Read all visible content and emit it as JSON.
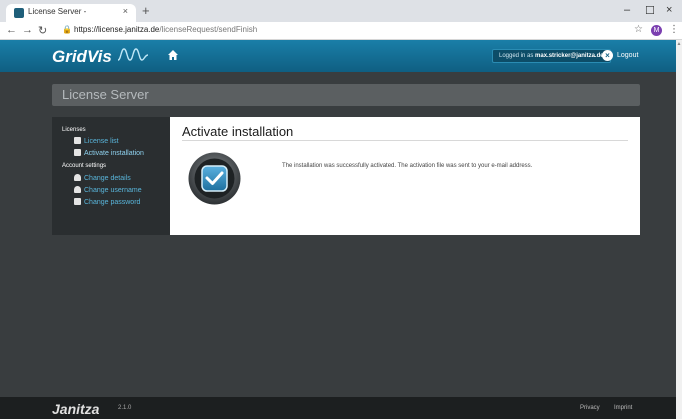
{
  "browser": {
    "tab_title": "License Server -",
    "tab_close": "×",
    "new_tab": "+",
    "url_host": "https://license.janitza.de",
    "url_path": "/licenseRequest/sendFinish",
    "profile_initial": "M",
    "minimize": "–",
    "maximize": "☐",
    "close": "×"
  },
  "header": {
    "logo_text": "GridVis",
    "logged_in_prefix": "Logged in as",
    "logged_in_user": "max.stricker@janitza.de",
    "logout_label": "Logout",
    "logout_icon": "×"
  },
  "page": {
    "title": "License Server"
  },
  "sidebar": {
    "licenses_heading": "Licenses",
    "license_list": "License list",
    "activate_installation": "Activate installation",
    "account_heading": "Account settings",
    "change_details": "Change details",
    "change_username": "Change username",
    "change_password": "Change password"
  },
  "panel": {
    "heading": "Activate installation",
    "message": "The installation was successfully activated. The activation file was sent to your e-mail address."
  },
  "footer": {
    "logo_text": "Janitza",
    "version": "2.1.0",
    "privacy": "Privacy",
    "imprint": "Imprint"
  },
  "colors": {
    "header_blue": "#1a7fa8",
    "link_blue": "#59b5da",
    "background": "#393d3f"
  }
}
